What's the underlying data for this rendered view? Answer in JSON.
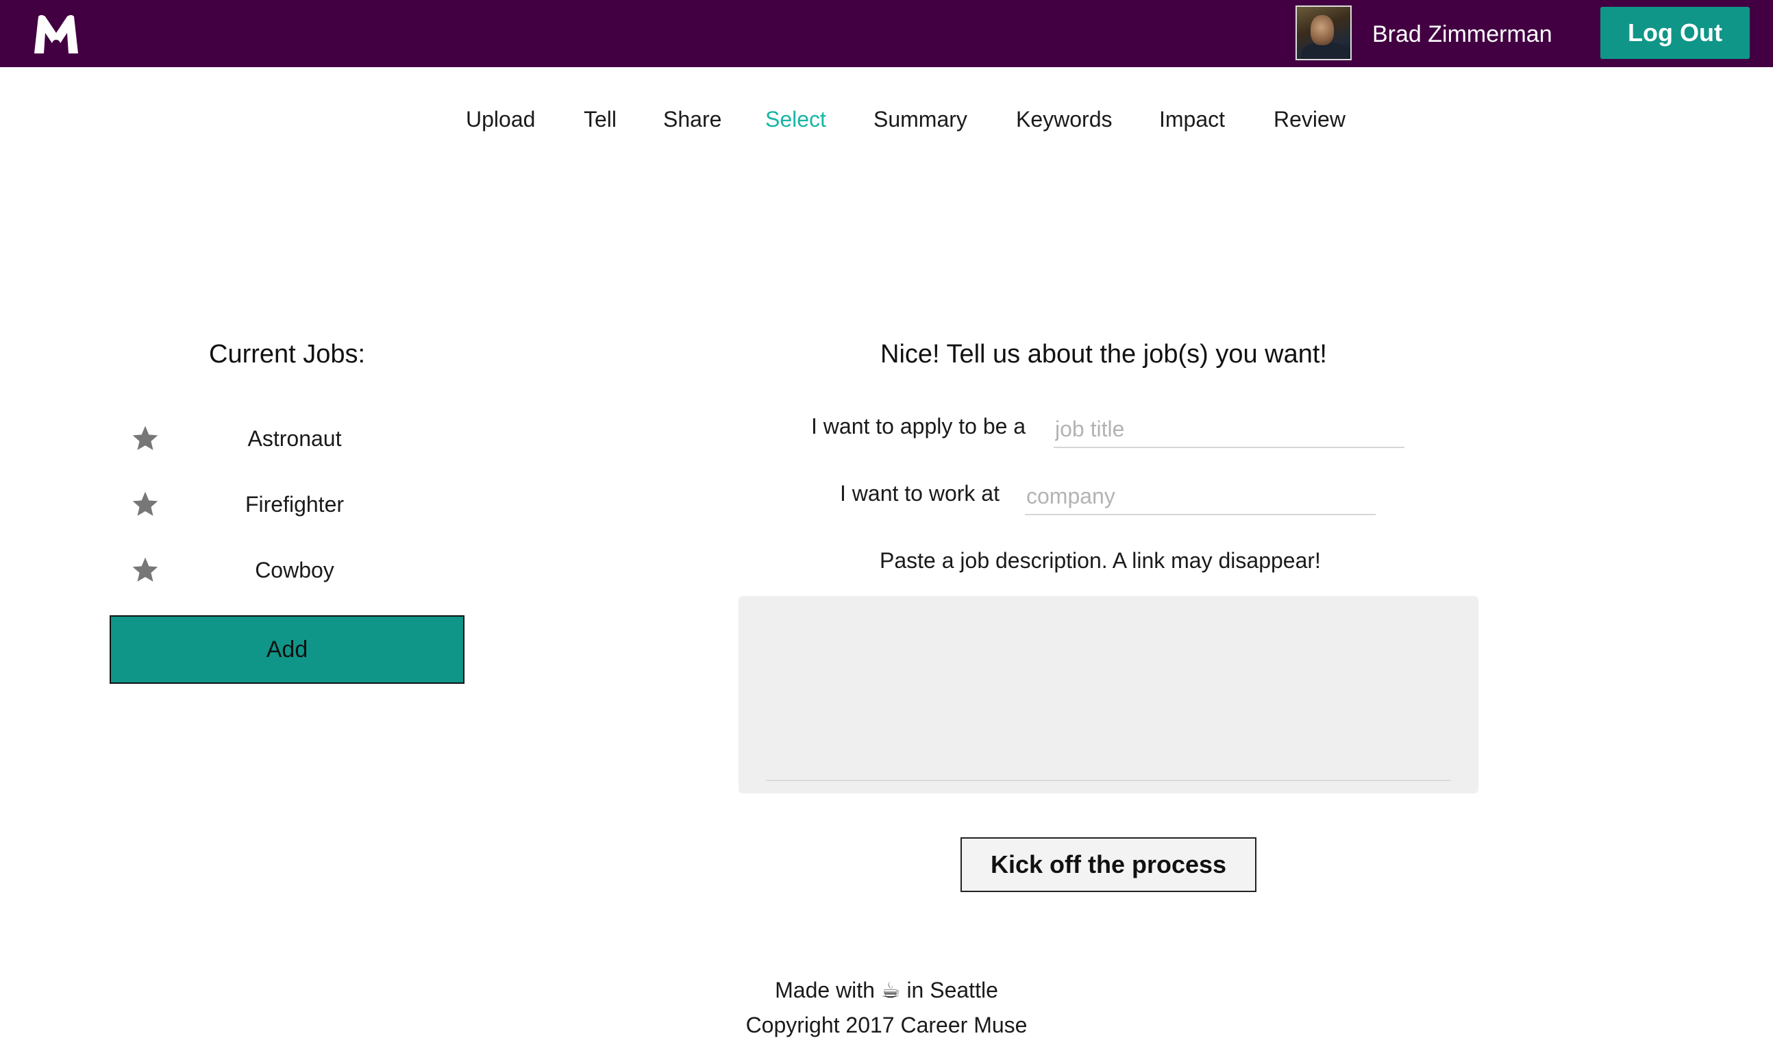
{
  "header": {
    "user_name": "Brad Zimmerman",
    "logout_label": "Log Out",
    "brand_color": "#420042",
    "accent_color": "#0f9688",
    "logo_icon": "m-logo-icon",
    "avatar_icon": "user-avatar-photo"
  },
  "nav": {
    "items": [
      "Upload",
      "Tell",
      "Share",
      "Select",
      "Summary",
      "Keywords",
      "Impact",
      "Review"
    ],
    "active": "Select",
    "active_color": "#19b5a5"
  },
  "current_jobs": {
    "title": "Current Jobs:",
    "items": [
      "Astronaut",
      "Firefighter",
      "Cowboy"
    ],
    "star_icon": "star-icon",
    "add_label": "Add"
  },
  "form": {
    "title": "Nice! Tell us about the job(s) you want!",
    "job_title_label": "I want to apply to be a",
    "job_title_placeholder": "job title",
    "job_title_value": "",
    "company_label": "I want to work at",
    "company_placeholder": "company",
    "company_value": "",
    "description_prompt": "Paste a job description. A link may disappear!",
    "description_value": "",
    "submit_label": "Kick off the process"
  },
  "footer": {
    "made_with_prefix": "Made with",
    "made_with_icon": "☕",
    "made_with_suffix": "in Seattle",
    "copyright": "Copyright 2017 Career Muse"
  }
}
